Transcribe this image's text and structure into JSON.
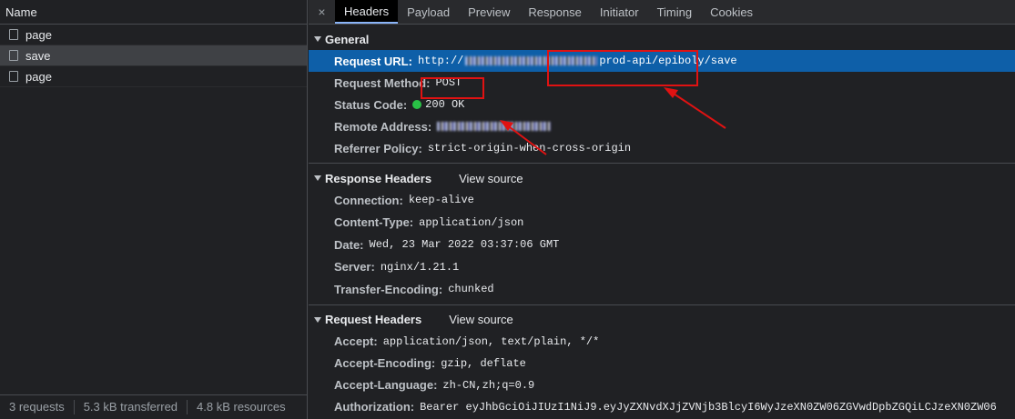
{
  "left": {
    "column_header": "Name",
    "requests": [
      {
        "name": "page",
        "selected": false
      },
      {
        "name": "save",
        "selected": true
      },
      {
        "name": "page",
        "selected": false
      }
    ],
    "footer": {
      "requests": "3 requests",
      "transferred": "5.3 kB transferred",
      "resources": "4.8 kB resources"
    }
  },
  "tabs": [
    "Headers",
    "Payload",
    "Preview",
    "Response",
    "Initiator",
    "Timing",
    "Cookies"
  ],
  "active_tab": "Headers",
  "close_glyph": "×",
  "general": {
    "title": "General",
    "request_url_label": "Request URL:",
    "request_url_prefix": "http://",
    "request_url_suffix": "prod-api/epiboly/save",
    "request_method_label": "Request Method:",
    "request_method": "POST",
    "status_code_label": "Status Code:",
    "status_code": "200 OK",
    "remote_address_label": "Remote Address:",
    "referrer_policy_label": "Referrer Policy:",
    "referrer_policy": "strict-origin-when-cross-origin"
  },
  "response_headers": {
    "title": "Response Headers",
    "view_source": "View source",
    "items": [
      {
        "key": "Connection:",
        "value": "keep-alive"
      },
      {
        "key": "Content-Type:",
        "value": "application/json"
      },
      {
        "key": "Date:",
        "value": "Wed, 23 Mar 2022 03:37:06 GMT"
      },
      {
        "key": "Server:",
        "value": "nginx/1.21.1"
      },
      {
        "key": "Transfer-Encoding:",
        "value": "chunked"
      }
    ]
  },
  "request_headers": {
    "title": "Request Headers",
    "view_source": "View source",
    "items": [
      {
        "key": "Accept:",
        "value": "application/json, text/plain, */*"
      },
      {
        "key": "Accept-Encoding:",
        "value": "gzip, deflate"
      },
      {
        "key": "Accept-Language:",
        "value": "zh-CN,zh;q=0.9"
      },
      {
        "key": "Authorization:",
        "value": "Bearer eyJhbGciOiJIUzI1NiJ9.eyJyZXNvdXJjZVNjb3BlcyI6WyJzeXN0ZW06ZGVwdDpbZGQiLCJzeXN0ZW06"
      }
    ]
  },
  "colors": {
    "background": "#202124",
    "highlight_row": "#0e5fa8",
    "annotation_red": "#e01212",
    "status_green": "#29c146"
  }
}
